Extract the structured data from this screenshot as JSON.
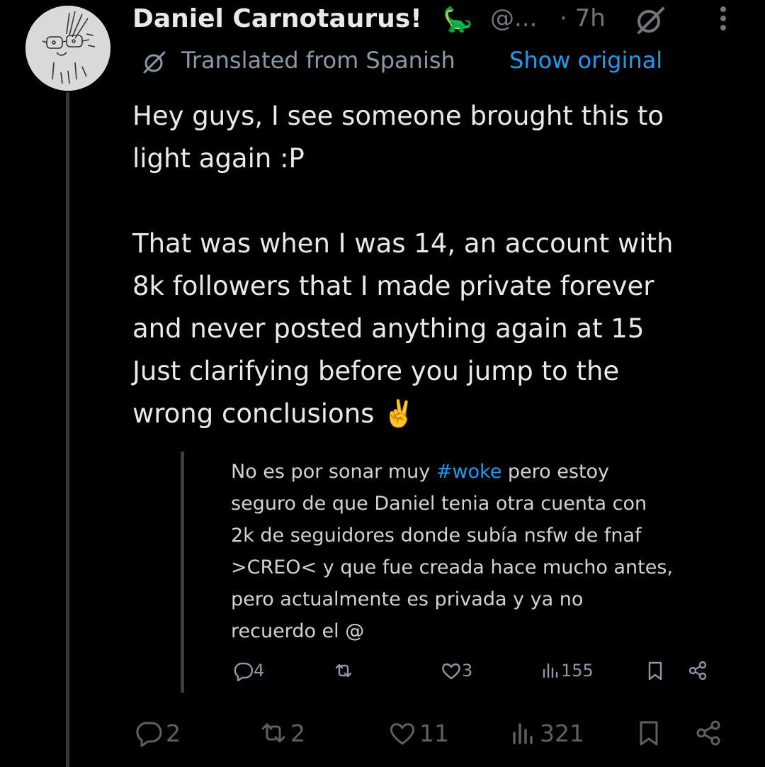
{
  "author": {
    "display_name": "Daniel Carnotaurus!",
    "emoji": "🦕",
    "handle": "@...",
    "separator": "·",
    "time": "7h"
  },
  "translation": {
    "label": "Translated from Spanish",
    "show_original": "Show original"
  },
  "tweet": {
    "text": "Hey guys, I see someone brought this to\nlight again :P\n\nThat was when I was 14, an account with\n8k followers that I made private forever\nand never posted anything again at 15\nJust clarifying before you jump to the\nwrong conclusions ✌️"
  },
  "quote": {
    "text_before": "No es por sonar muy ",
    "hashtag": "#woke",
    "text_after": " pero estoy\nseguro de que Daniel tenia otra cuenta con\n2k de seguidores donde subía nsfw de fnaf\n>CREO< y que fue creada hace mucho antes,\npero actualmente es privada y ya no\nrecuerdo el @",
    "actions": {
      "replies": "4",
      "retweets": "",
      "likes": "3",
      "views": "155"
    }
  },
  "actions": {
    "replies": "2",
    "retweets": "2",
    "likes": "11",
    "views": "321"
  },
  "colors": {
    "background": "#000000",
    "text": "#e7e9ea",
    "secondary": "#71767b",
    "accent_link": "#1d9bf0"
  }
}
